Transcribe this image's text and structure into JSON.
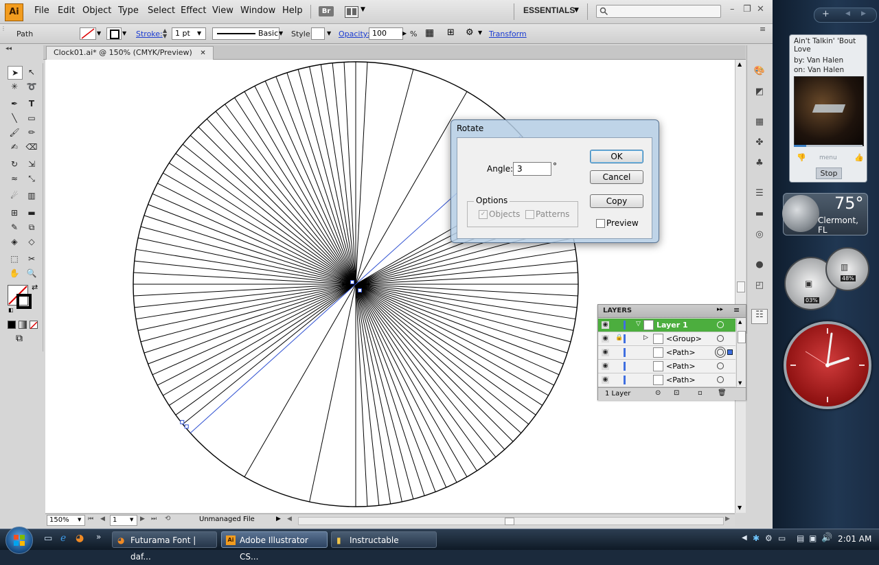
{
  "menubar": {
    "logo": "Ai",
    "items": [
      "File",
      "Edit",
      "Object",
      "Type",
      "Select",
      "Effect",
      "View",
      "Window",
      "Help"
    ],
    "bridge": "Br",
    "workspace": "ESSENTIALS"
  },
  "control": {
    "selection": "Path",
    "stroke_label": "Stroke:",
    "stroke_weight": "1 pt",
    "brush": "Basic",
    "style_label": "Style:",
    "opacity_label": "Opacity:",
    "opacity": "100",
    "opacity_unit": "%",
    "transform_label": "Transform"
  },
  "document": {
    "tab_title": "Clock01.ai* @ 150% (CMYK/Preview)",
    "zoom": "150%",
    "artboard": "1",
    "status": "Unmanaged File"
  },
  "rotate_dialog": {
    "title": "Rotate",
    "angle_label": "Angle:",
    "angle_value": "3",
    "angle_unit": "°",
    "options_legend": "Options",
    "objects_label": "Objects",
    "patterns_label": "Patterns",
    "ok_label": "OK",
    "cancel_label": "Cancel",
    "copy_label": "Copy",
    "preview_label": "Preview"
  },
  "layers_panel": {
    "title": "LAYERS",
    "rows": [
      "Layer 1",
      "<Group>",
      "<Path>",
      "<Path>",
      "<Path>"
    ],
    "footer": "1 Layer",
    "layer_color": "#4cae3e"
  },
  "media_widget": {
    "track": "Ain't Talkin' 'Bout Love",
    "artist": "by: Van Halen",
    "album": "on: Van Halen",
    "menu": "menu",
    "stop": "Stop"
  },
  "weather": {
    "temp": "75°",
    "city": "Clermont, FL"
  },
  "meters": {
    "cpu": "03%",
    "ram": "48%"
  },
  "taskbar": {
    "tasks": [
      "Futurama Font | daf...",
      "Adobe Illustrator CS...",
      "Instructable"
    ],
    "time": "2:01 AM"
  }
}
